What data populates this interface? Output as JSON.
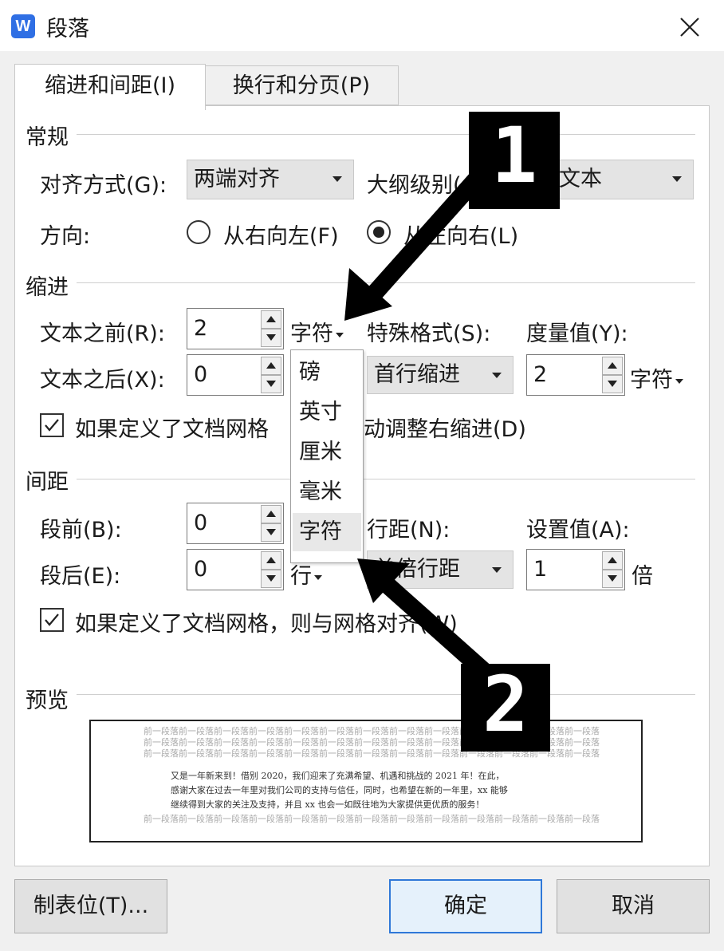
{
  "window": {
    "title": "段落",
    "app_icon_letter": "W"
  },
  "tabs": [
    {
      "label": "缩进和间距(I)",
      "active": true
    },
    {
      "label": "换行和分页(P)",
      "active": false
    }
  ],
  "general": {
    "section_title": "常规",
    "alignment_label": "对齐方式(G):",
    "alignment_value": "两端对齐",
    "outline_label": "大纲级别(",
    "outline_value": "文本",
    "direction_label": "方向:",
    "rtl_label": "从右向左(F)",
    "ltr_label": "从左向右(L)",
    "ltr_selected": true
  },
  "indent": {
    "section_title": "缩进",
    "before_label": "文本之前(R):",
    "before_value": "2",
    "before_unit": "字符",
    "after_label": "文本之后(X):",
    "after_value": "0",
    "special_label": "特殊格式(S):",
    "special_value": "首行缩进",
    "measure_label": "度量值(Y):",
    "measure_value": "2",
    "measure_unit": "字符",
    "grid_checkbox_label_a": "如果定义了文档网格",
    "grid_checkbox_label_b": "动调整右缩进(D)",
    "grid_checked": true
  },
  "unit_dropdown": {
    "options": [
      "磅",
      "英寸",
      "厘米",
      "毫米",
      "字符"
    ],
    "selected": "字符"
  },
  "spacing": {
    "section_title": "间距",
    "before_label": "段前(B):",
    "before_value": "0",
    "after_label": "段后(E):",
    "after_value": "0",
    "after_unit": "行",
    "line_label": "行距(N):",
    "line_value": "单倍行距",
    "setting_label": "设置值(A):",
    "setting_value": "1",
    "setting_unit": "倍",
    "snap_checkbox_label": "如果定义了文档网格，则与网格对齐(W)",
    "snap_checked": true
  },
  "preview": {
    "section_title": "预览",
    "grey_line": "前一段落前一段落前一段落前一段落前一段落前一段落前一段落前一段落前一段落前一段落前一段落前一段落前一段落",
    "text_lines": [
      "又是一年新来到！借别 2020，我们迎来了充满希望、机遇和挑战的 2021 年！在此，",
      "感谢大家在过去一年里对我们公司的支持与信任，同时，也希望在新的一年里，xx 能够",
      "继续得到大家的关注及支持，并且 xx 也会一如既往地为大家提供更优质的服务！"
    ]
  },
  "buttons": {
    "tabs": "制表位(T)...",
    "ok": "确定",
    "cancel": "取消"
  },
  "annotations": {
    "label_1": "1",
    "label_2": "2"
  }
}
